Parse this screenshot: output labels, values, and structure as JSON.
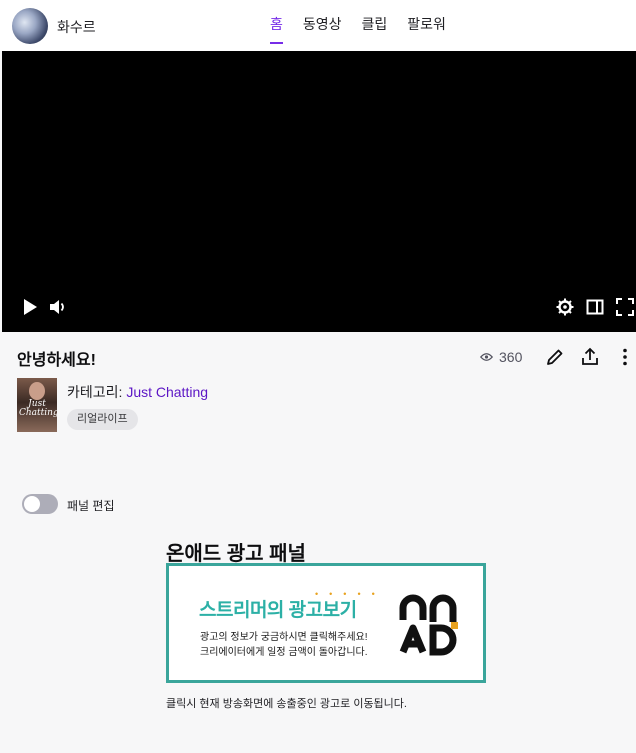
{
  "header": {
    "channel_name": "화수르",
    "tabs": [
      {
        "label": "홈",
        "active": true
      },
      {
        "label": "동영상",
        "active": false
      },
      {
        "label": "클립",
        "active": false
      },
      {
        "label": "팔로워",
        "active": false
      }
    ]
  },
  "player": {
    "controls_left": [
      "play-icon",
      "volume-icon"
    ],
    "controls_right": [
      "settings-icon",
      "theatre-mode-icon",
      "fullscreen-icon"
    ]
  },
  "stream": {
    "title": "안녕하세요!",
    "viewer_count": "360",
    "category_label": "카테고리:",
    "category_name": "Just Chatting",
    "tag": "리얼라이프",
    "box_art_text": "Just Chatting"
  },
  "panel_edit": {
    "label": "패널 편집",
    "enabled": false
  },
  "ad_panel": {
    "title": "온애드 광고 패널",
    "headline": "스트리머의 광고보기",
    "line1": "광고의 정보가 궁금하시면 클릭해주세요!",
    "line2": "크리에이터에게 일정 금액이 돌아갑니다.",
    "logo_text": "ON AD",
    "note": "클릭시 현재 방송화면에 송출중인 광고로 이동됩니다."
  },
  "colors": {
    "accent": "#772ce8",
    "category_link": "#5c16c5",
    "banner_teal": "#3aa59b"
  }
}
